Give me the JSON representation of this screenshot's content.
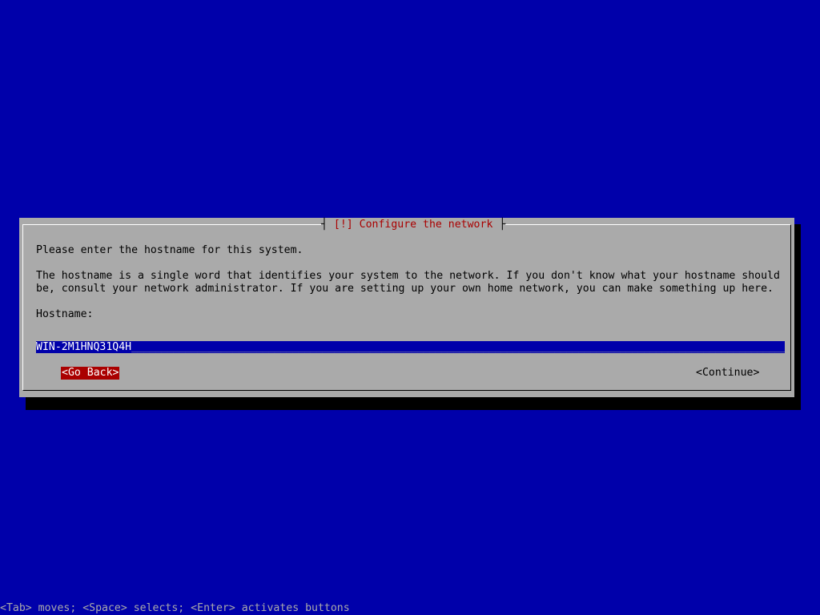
{
  "dialog": {
    "title": "[!] Configure the network",
    "intro": "Please enter the hostname for this system.",
    "description_line1": "The hostname is a single word that identifies your system to the network. If you don't know what your hostname should",
    "description_line2": "be, consult your network administrator. If you are setting up your own home network, you can make something up here.",
    "field_label": "Hostname:",
    "hostname_value": "WIN-2M1HNQ31Q4H",
    "back_button": "<Go Back>",
    "continue_button": "<Continue>"
  },
  "footer": {
    "help_text": "<Tab> moves; <Space> selects; <Enter> activates buttons"
  },
  "colors": {
    "background": "#0000aa",
    "dialog": "#aaaaaa",
    "title_text": "#aa0000",
    "selected_button": "#aa0000",
    "input_background": "#0000aa"
  }
}
